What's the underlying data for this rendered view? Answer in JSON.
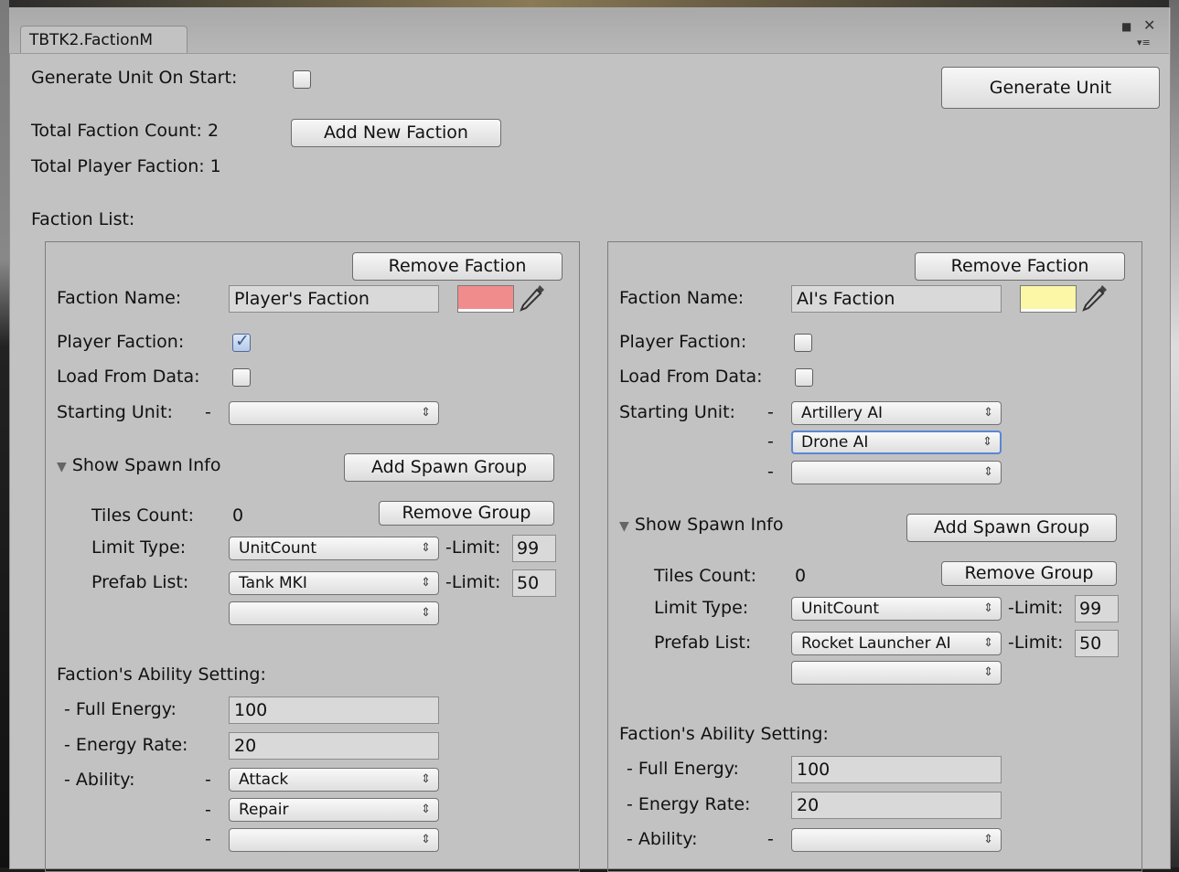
{
  "window": {
    "tab_title": "TBTK2.FactionM",
    "maximize_glyph": "■",
    "close_glyph": "✕",
    "menu_glyph": "▾≡"
  },
  "top": {
    "generate_on_start_label": "Generate Unit On Start:",
    "generate_on_start_checked": false,
    "generate_unit_button": "Generate Unit",
    "total_faction_count": "Total Faction Count: 2",
    "add_new_faction_button": "Add New Faction",
    "total_player_faction": "Total Player Faction: 1",
    "faction_list_label": "Faction List:"
  },
  "common": {
    "remove_faction": "Remove Faction",
    "faction_name_label": "Faction Name:",
    "player_faction_label": "Player Faction:",
    "load_from_data_label": "Load From Data:",
    "starting_unit_label": "Starting Unit:",
    "dash": "-",
    "show_spawn_info": "Show Spawn Info",
    "add_spawn_group": "Add Spawn Group",
    "tiles_count_label": "Tiles Count:",
    "remove_group": "Remove Group",
    "limit_type_label": "Limit Type:",
    "limit_label": "-Limit:",
    "prefab_list_label": "Prefab List:",
    "ability_setting_label": "Faction's Ability Setting:",
    "full_energy_label": "- Full Energy:",
    "energy_rate_label": "- Energy Rate:",
    "ability_label": "- Ability:",
    "select_arrow": "⇕",
    "foldout_icon": "▼",
    "picker_icon": "eyedropper"
  },
  "factions": [
    {
      "name": "Player's Faction",
      "color": "#f08c8c",
      "player_faction": true,
      "load_from_data": false,
      "starting_units": [
        ""
      ],
      "tiles_count": "0",
      "limit_type": "UnitCount",
      "limit_type_limit": "99",
      "prefabs": [
        "Tank MKI",
        ""
      ],
      "prefab_limit": "50",
      "full_energy": "100",
      "energy_rate": "20",
      "abilities": [
        "Attack",
        "Repair",
        ""
      ]
    },
    {
      "name": "AI's Faction",
      "color": "#fbf7a6",
      "player_faction": false,
      "load_from_data": false,
      "starting_units": [
        "Artillery AI",
        "Drone AI",
        ""
      ],
      "tiles_count": "0",
      "limit_type": "UnitCount",
      "limit_type_limit": "99",
      "prefabs": [
        "Rocket Launcher AI",
        ""
      ],
      "prefab_limit": "50",
      "full_energy": "100",
      "energy_rate": "20",
      "abilities": [
        ""
      ]
    }
  ]
}
